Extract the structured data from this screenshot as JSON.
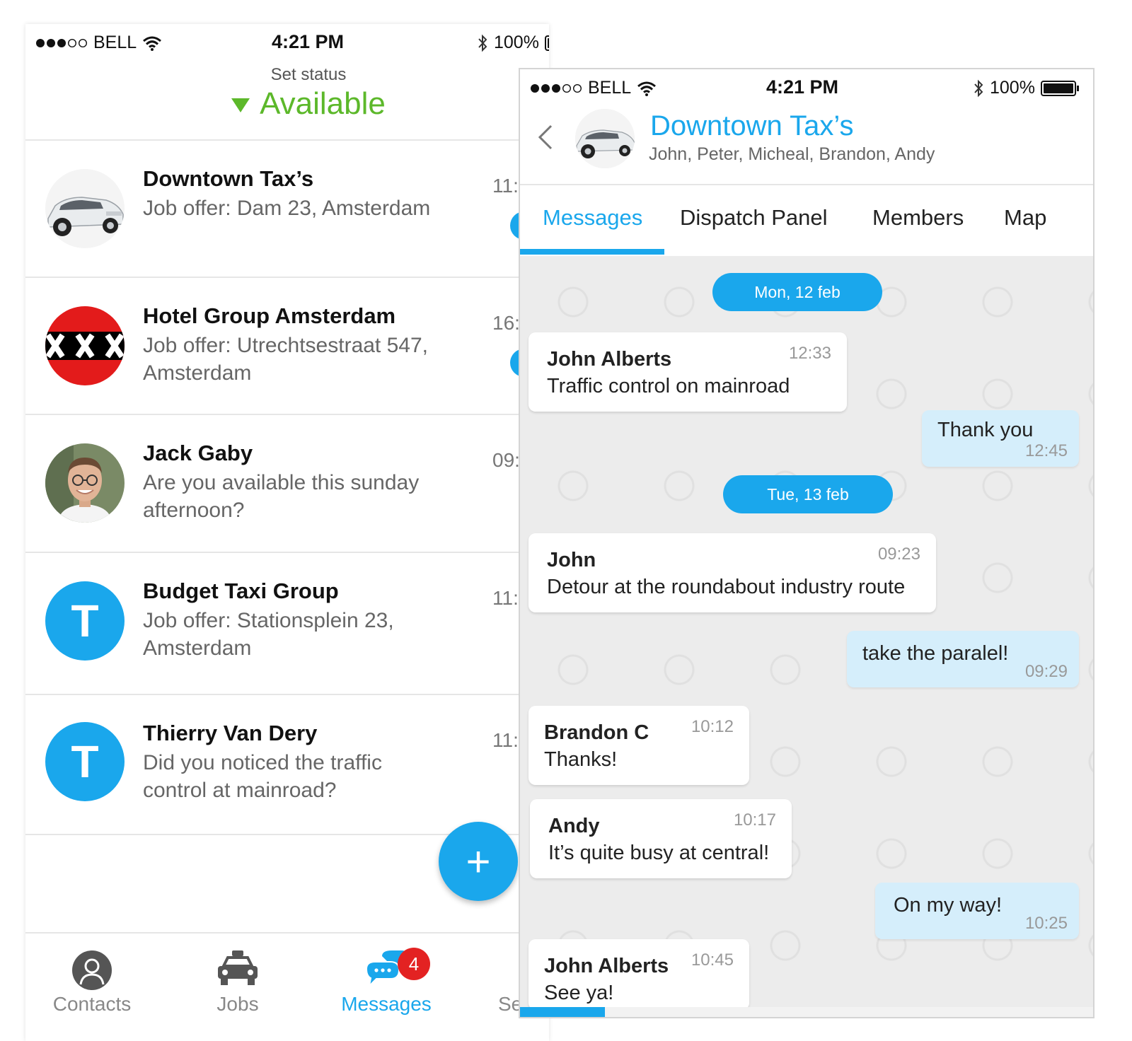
{
  "status_bar": {
    "carrier": "BELL",
    "time": "4:21 PM",
    "battery": "100%"
  },
  "left": {
    "status_label": "Set status",
    "status_value": "Available",
    "status_color": "#5cb82a",
    "conversations": [
      {
        "name": "Downtown Tax’s",
        "preview": "Job offer: Dam 23, Amsterdam",
        "time": "11:",
        "avatar": "limousine-photo",
        "unread": true
      },
      {
        "name": "Hotel Group Amsterdam",
        "preview": "Job offer: Utrechtsestraat 547, Amsterdam",
        "time": "16:",
        "avatar": "amsterdam-xxx-logo",
        "unread": true
      },
      {
        "name": "Jack Gaby",
        "preview": "Are you available this sunday afternoon?",
        "time": "09:",
        "avatar": "person-photo",
        "unread": false
      },
      {
        "name": "Budget Taxi Group",
        "preview": "Job offer: Stationsplein 23, Amsterdam",
        "time": "11:",
        "avatar_letter": "T",
        "unread": false
      },
      {
        "name": "Thierry Van Dery",
        "preview": "Did you noticed the traffic control at mainroad?",
        "time": "11:",
        "avatar_letter": "T",
        "unread": false
      }
    ],
    "fab_label": "+",
    "tabs": [
      {
        "label": "Contacts",
        "icon": "person-icon"
      },
      {
        "label": "Jobs",
        "icon": "taxi-icon"
      },
      {
        "label": "Messages",
        "icon": "chat-bubbles-icon",
        "badge": "4",
        "active": true
      },
      {
        "label": "Se",
        "icon": "settings-icon"
      }
    ]
  },
  "right": {
    "group_title": "Downtown Tax’s",
    "members": "John, Peter, Micheal, Brandon, Andy",
    "tabs": [
      {
        "label": "Messages",
        "active": true
      },
      {
        "label": "Dispatch Panel"
      },
      {
        "label": "Members"
      },
      {
        "label": "Map"
      }
    ],
    "messages": [
      {
        "type": "date",
        "text": "Mon, 12 feb"
      },
      {
        "type": "in",
        "sender": "John Alberts",
        "time": "12:33",
        "text": "Traffic control on mainroad"
      },
      {
        "type": "out",
        "time": "12:45",
        "text": "Thank you"
      },
      {
        "type": "date",
        "text": "Tue, 13 feb"
      },
      {
        "type": "in",
        "sender": "John",
        "time": "09:23",
        "text": "Detour at the roundabout industry route"
      },
      {
        "type": "out",
        "time": "09:29",
        "text": "take the paralel!"
      },
      {
        "type": "in",
        "sender": "Brandon C",
        "time": "10:12",
        "text": "Thanks!"
      },
      {
        "type": "in",
        "sender": "Andy",
        "time": "10:17",
        "text": "It’s quite busy at central!"
      },
      {
        "type": "out",
        "time": "10:25",
        "text": "On my way!"
      },
      {
        "type": "in",
        "sender": "John Alberts",
        "time": "10:45",
        "text": "See ya!"
      }
    ]
  },
  "colors": {
    "accent": "#1aa7ec",
    "available": "#5cb82a",
    "badge": "#e32222",
    "outgoing_bubble": "#d5eefb",
    "chat_background": "#ececec"
  }
}
